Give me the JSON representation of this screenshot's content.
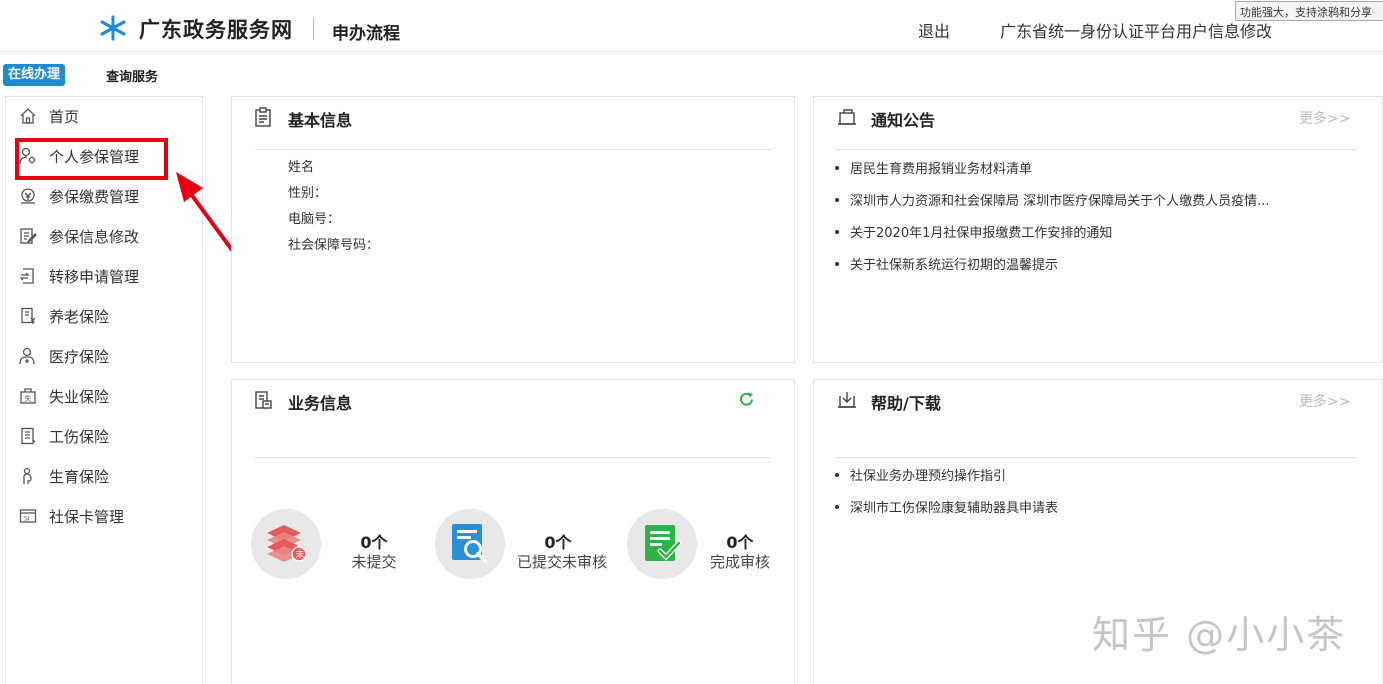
{
  "header": {
    "site_title": "广东政务服务网",
    "sub_title": "申办流程",
    "logout": "退出",
    "profile_link": "广东省统一身份认证平台用户信息修改",
    "toolbar_tip": "功能强大，支持涂鸦和分享"
  },
  "tabs": {
    "online": "在线办理",
    "query": "查询服务"
  },
  "sidebar": {
    "items": [
      {
        "label": "首页",
        "icon": "home-icon"
      },
      {
        "label": "个人参保管理",
        "icon": "person-gear-icon"
      },
      {
        "label": "参保缴费管理",
        "icon": "payment-icon"
      },
      {
        "label": "参保信息修改",
        "icon": "edit-document-icon"
      },
      {
        "label": "转移申请管理",
        "icon": "transfer-icon"
      },
      {
        "label": "养老保险",
        "icon": "pension-icon"
      },
      {
        "label": "医疗保险",
        "icon": "medical-person-icon"
      },
      {
        "label": "失业保险",
        "icon": "unemployment-icon"
      },
      {
        "label": "工伤保险",
        "icon": "injury-document-icon"
      },
      {
        "label": "生育保险",
        "icon": "maternity-icon"
      },
      {
        "label": "社保卡管理",
        "icon": "card-icon"
      }
    ]
  },
  "basic_info": {
    "title": "基本信息",
    "fields": [
      {
        "label": "姓名"
      },
      {
        "label": "性别："
      },
      {
        "label": "电脑号："
      },
      {
        "label": "社会保障号码："
      }
    ]
  },
  "notice": {
    "title": "通知公告",
    "more": "更多>>",
    "items": [
      "居民生育费用报销业务材料清单",
      "深圳市人力资源和社会保障局 深圳市医疗保障局关于个人缴费人员疫情...",
      "关于2020年1月社保申报缴费工作安排的通知",
      "关于社保新系统运行初期的温馨提示"
    ]
  },
  "business": {
    "title": "业务信息",
    "stats": [
      {
        "count": "0个",
        "label": "未提交",
        "icon": "unsubmitted-stack-icon"
      },
      {
        "count": "0个",
        "label": "已提交未审核",
        "icon": "search-document-icon"
      },
      {
        "count": "0个",
        "label": "完成审核",
        "icon": "approved-document-icon"
      }
    ]
  },
  "help": {
    "title": "帮助/下载",
    "more": "更多>>",
    "items": [
      "社保业务办理预约操作指引",
      "深圳市工伤保险康复辅助器具申请表"
    ]
  },
  "watermark": "知乎 @小小茶",
  "colors": {
    "accent": "#1c8bd3",
    "highlight": "#e60012",
    "green": "#2db34a",
    "red_icon": "#e25b5b"
  }
}
